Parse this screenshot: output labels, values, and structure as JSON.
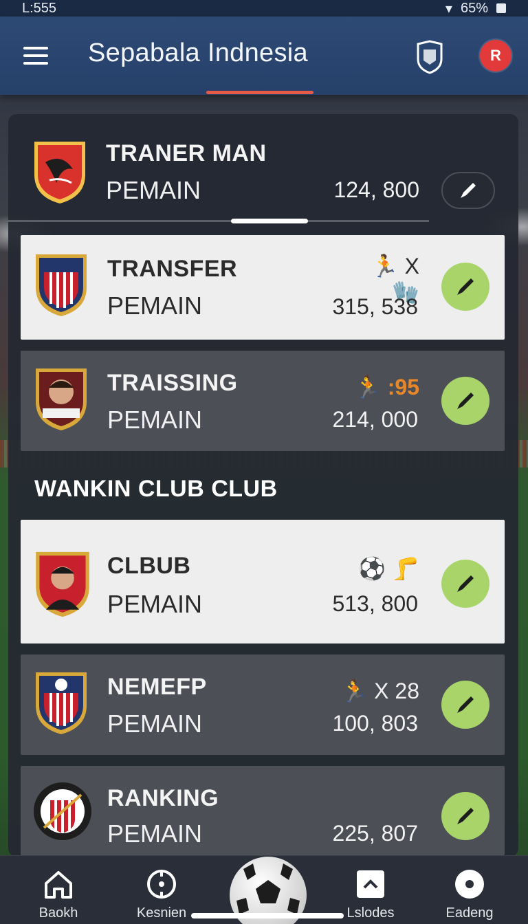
{
  "status_bar": {
    "time": "L:555",
    "battery": "65%"
  },
  "app": {
    "title": "Sepabala Indnesia",
    "profile_label": "R"
  },
  "top_card": {
    "title": "TRANER MAN",
    "subtitle": "PEMAIN",
    "value": "124, 800"
  },
  "rows": [
    {
      "title": "TRANSFER",
      "subtitle": "PEMAIN",
      "value": "315, 538",
      "extra": "X"
    },
    {
      "title": "TRAISSING",
      "subtitle": "PEMAIN",
      "value": "214, 000",
      "extra": ":95"
    }
  ],
  "section": {
    "title": "WANKIN CLUB CLUB"
  },
  "club_rows": [
    {
      "title": "CLBUB",
      "subtitle": "PEMAIN",
      "value": "513, 800",
      "extra": ""
    },
    {
      "title": "NEMEFP",
      "subtitle": "PEMAIN",
      "value": "100, 803",
      "extra": "X 28"
    },
    {
      "title": "RANKING",
      "subtitle": "PEMAIN",
      "value": "225, 807",
      "extra": ""
    }
  ],
  "bottom_nav": [
    {
      "label": "Baokh",
      "icon": "home-icon"
    },
    {
      "label": "Kesnien",
      "icon": "compass-icon"
    },
    {
      "label": "Lslodes",
      "icon": "chevron-up-icon"
    },
    {
      "label": "Eadeng",
      "icon": "record-icon"
    }
  ],
  "colors": {
    "appbar": "#2d4a75",
    "accent": "#e65a46",
    "go_button": "#a8d46a",
    "light_row": "#eeeeee",
    "dark_row": "#4d4f57",
    "highlight_value": "#e8872a"
  }
}
